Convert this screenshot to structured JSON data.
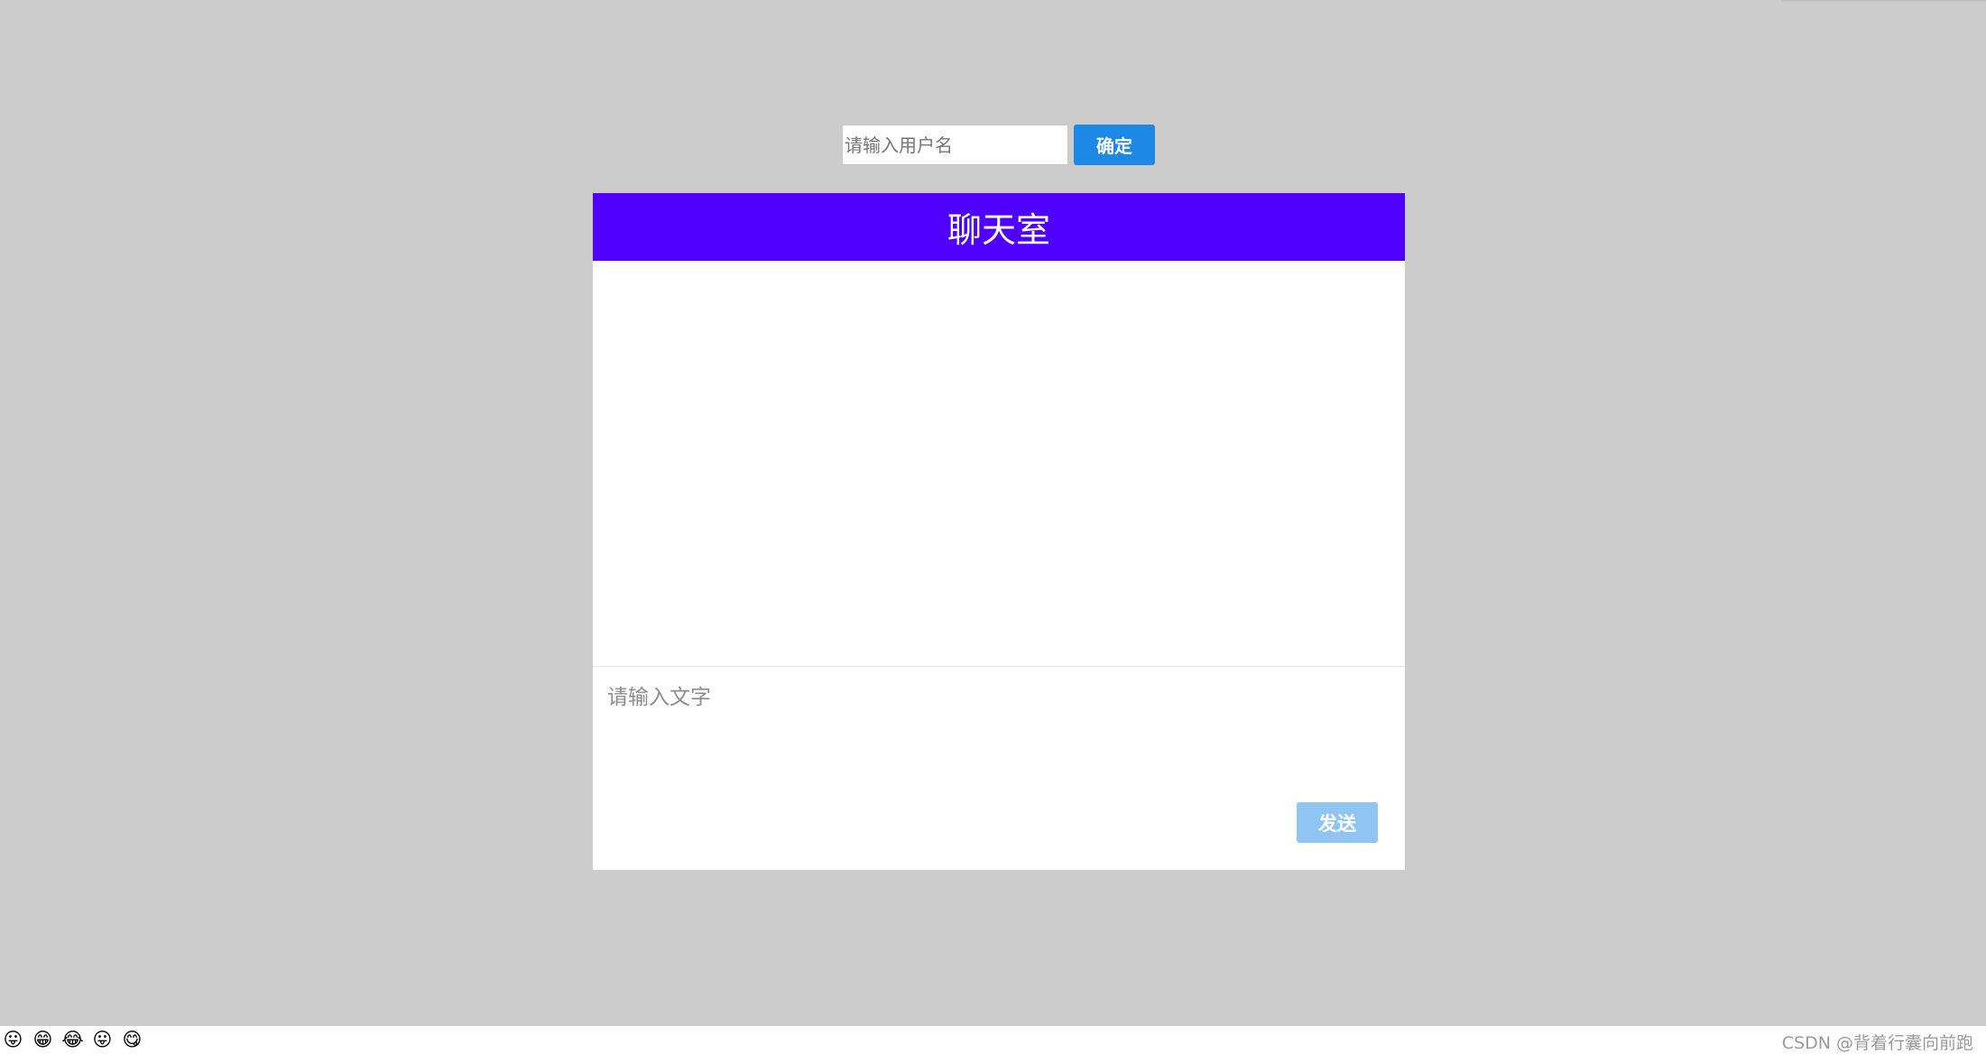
{
  "login": {
    "username_placeholder": "请输入用户名",
    "confirm_label": "确定"
  },
  "chat": {
    "title": "聊天室",
    "message_placeholder": "请输入文字",
    "send_label": "发送"
  },
  "emojis": [
    {
      "glyph": "😛",
      "name": "tongue-face-icon"
    },
    {
      "glyph": "😁",
      "name": "grin-face-icon"
    },
    {
      "glyph": "😂",
      "name": "tears-of-joy-icon"
    },
    {
      "glyph": "😛",
      "name": "tongue-face-icon"
    },
    {
      "glyph": "😋",
      "name": "yum-face-icon"
    }
  ],
  "watermark": "CSDN @背着行囊向前跑",
  "colors": {
    "background": "#cccccc",
    "header": "#5000ff",
    "confirm_button": "#1e88e5",
    "send_button": "#90c4f2"
  }
}
